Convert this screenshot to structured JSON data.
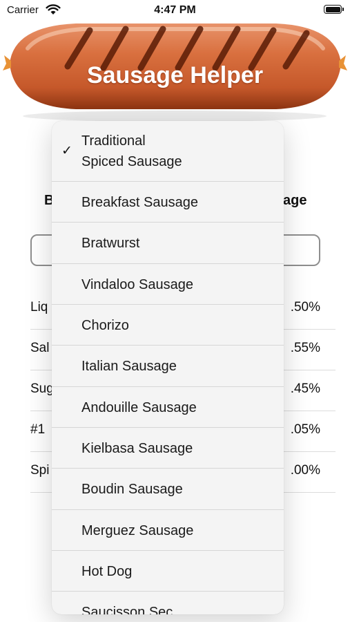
{
  "status_bar": {
    "carrier": "Carrier",
    "time": "4:47 PM"
  },
  "header": {
    "title": "Sausage Helper"
  },
  "background": {
    "label_left": "B",
    "label_right": "age",
    "rows": [
      {
        "name": "Liq",
        "value": ".50%"
      },
      {
        "name": "Sal",
        "value": ".55%"
      },
      {
        "name": "Sug",
        "value": ".45%"
      },
      {
        "name": "#1",
        "value": ".05%"
      },
      {
        "name": "Spi",
        "value": ".00%"
      }
    ]
  },
  "menu": {
    "selected_item": "Traditional Spiced Sausage",
    "selected_line1": "Traditional",
    "selected_line2": "Spiced Sausage",
    "items": [
      "Breakfast Sausage",
      "Bratwurst",
      "Vindaloo Sausage",
      "Chorizo",
      "Italian Sausage",
      "Andouille Sausage",
      "Kielbasa Sausage",
      "Boudin Sausage",
      "Merguez Sausage",
      "Hot Dog",
      "Saucisson Sec"
    ]
  }
}
